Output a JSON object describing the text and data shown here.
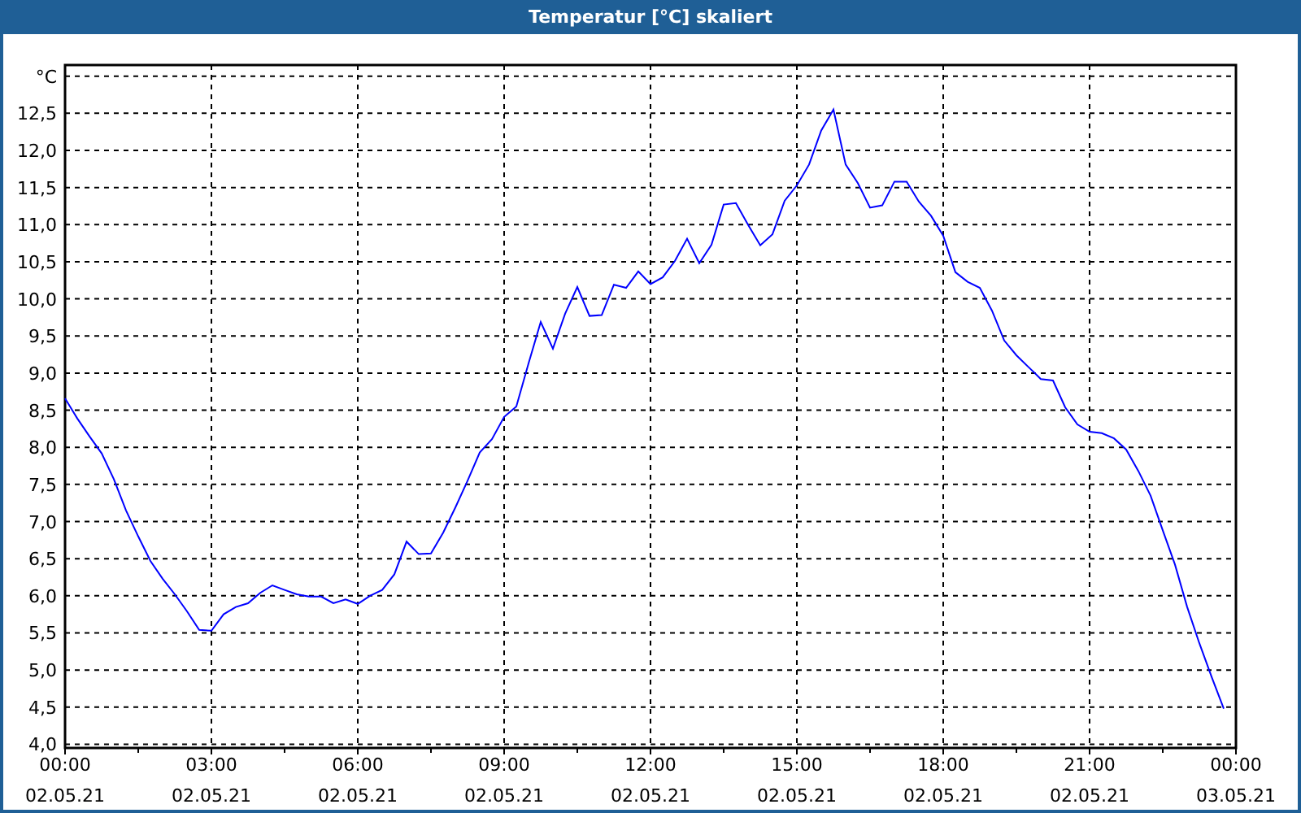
{
  "window": {
    "title": "Temperatur [°C] skaliert"
  },
  "chart": {
    "chart_data": {
      "type": "line",
      "grid": true,
      "categories": [
        "00:00\n02.05.21",
        null,
        null,
        null,
        null,
        null,
        null,
        null,
        null,
        null,
        null,
        null,
        "03:00\n02.05.21",
        null,
        null,
        null,
        null,
        null,
        null,
        null,
        null,
        null,
        null,
        null,
        "06:00\n02.05.21",
        null,
        null,
        null,
        null,
        null,
        null,
        null,
        null,
        null,
        null,
        null,
        "09:00\n02.05.21",
        null,
        null,
        null,
        null,
        null,
        null,
        null,
        null,
        null,
        null,
        null,
        "12:00\n02.05.21",
        null,
        null,
        null,
        null,
        null,
        null,
        null,
        null,
        null,
        null,
        null,
        "15:00\n02.05.21",
        null,
        null,
        null,
        null,
        null,
        null,
        null,
        null,
        null,
        null,
        null,
        "18:00\n02.05.21",
        null,
        null,
        null,
        null,
        null,
        null,
        null,
        null,
        null,
        null,
        null,
        "21:00\n02.05.21",
        null,
        null,
        null,
        null,
        null,
        null,
        null,
        null,
        null,
        null,
        null,
        "00:00\n03.05.21"
      ],
      "series": [
        {
          "color": "#0000ff",
          "values": [
            8.66,
            8.39,
            8.15,
            7.92,
            7.57,
            7.15,
            6.8,
            6.47,
            6.23,
            6.02,
            5.79,
            5.54,
            5.53,
            5.75,
            5.85,
            5.9,
            6.04,
            6.14,
            6.08,
            6.02,
            5.99,
            5.99,
            5.9,
            5.95,
            5.89,
            6.0,
            6.08,
            6.29,
            6.73,
            6.56,
            6.57,
            6.85,
            7.19,
            7.55,
            7.93,
            8.11,
            8.41,
            8.55,
            9.13,
            9.69,
            9.33,
            9.8,
            10.16,
            9.77,
            9.78,
            10.19,
            10.15,
            10.37,
            10.2,
            10.29,
            10.51,
            10.81,
            10.48,
            10.73,
            11.27,
            11.29,
            11.0,
            10.72,
            10.87,
            11.32,
            11.53,
            11.81,
            12.27,
            12.55,
            11.81,
            11.56,
            11.23,
            11.26,
            11.58,
            11.58,
            11.31,
            11.12,
            10.85,
            10.36,
            10.23,
            10.15,
            9.84,
            9.44,
            9.24,
            9.08,
            8.92,
            8.9,
            8.54,
            8.31,
            8.21,
            8.19,
            8.12,
            7.97,
            7.68,
            7.35,
            6.88,
            6.42,
            5.85,
            5.36,
            4.91,
            4.48,
            null
          ]
        }
      ],
      "ylim": [
        3.95,
        13.15
      ],
      "yticks": [
        {
          "value": 4,
          "label": "4,0"
        },
        {
          "value": 4.5,
          "label": "4,5"
        },
        {
          "value": 5,
          "label": "5,0"
        },
        {
          "value": 5.5,
          "label": "5,5"
        },
        {
          "value": 6,
          "label": "6,0"
        },
        {
          "value": 6.5,
          "label": "6,5"
        },
        {
          "value": 7,
          "label": "7,0"
        },
        {
          "value": 7.5,
          "label": "7,5"
        },
        {
          "value": 8,
          "label": "8,0"
        },
        {
          "value": 8.5,
          "label": "8,5"
        },
        {
          "value": 9,
          "label": "9,0"
        },
        {
          "value": 9.5,
          "label": "9,5"
        },
        {
          "value": 10,
          "label": "10,0"
        },
        {
          "value": 10.5,
          "label": "10,5"
        },
        {
          "value": 11,
          "label": "11,0"
        },
        {
          "value": 11.5,
          "label": "11,5"
        },
        {
          "value": 12,
          "label": "12,0"
        },
        {
          "value": 12.5,
          "label": "12,5"
        },
        {
          "value": 13,
          "label": "°C"
        }
      ]
    }
  }
}
